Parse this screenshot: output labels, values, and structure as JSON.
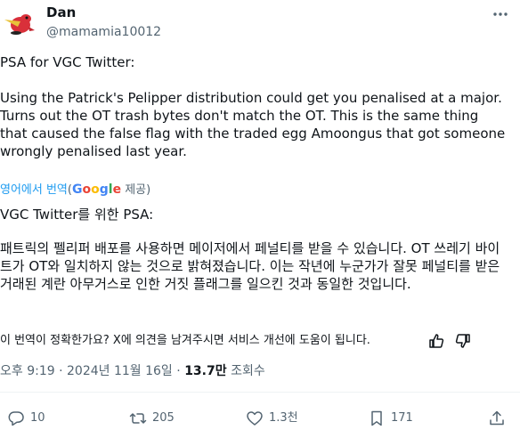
{
  "author": {
    "name": "Dan",
    "handle": "@mamamia10012"
  },
  "tweet": {
    "original_p1": "PSA for VGC Twitter:",
    "original_p2": "Using the Patrick's Pelipper distribution could get you penalised at a major. Turns out the OT trash bytes don't match the OT. This is the same thing that caused the false flag with the traded egg Amoongus that got someone wrongly penalised last year."
  },
  "translation": {
    "link_text": "영어에서 번역",
    "google_label": "Google",
    "paren_open": "(",
    "suffix": " 제공)",
    "p1": "VGC Twitter를 위한 PSA:",
    "p2": "패트릭의 펠리퍼 배포를 사용하면 메이저에서 페널티를 받을 수 있습니다. OT 쓰레기 바이트가 OT와 일치하지 않는 것으로 밝혀졌습니다. 이는 작년에 누군가가 잘못 페널티를 받은 거래된 계란 아무거스로 인한 거짓 플래그를 일으킨 것과 동일한 것입니다.",
    "feedback_question": "이 번역이 정확한가요? X에 의견을 남겨주시면 서비스 개선에 도움이 됩니다."
  },
  "meta": {
    "time": "오후 9:19",
    "dot1": " · ",
    "date": "2024년 11월 16일",
    "dot2": " · ",
    "views": "13.7만",
    "views_label": " 조회수"
  },
  "actions": {
    "replies": "10",
    "reposts": "205",
    "likes": "1.3천",
    "bookmarks": "171"
  },
  "icons": [
    "more-icon",
    "thumbs-up-icon",
    "thumbs-down-icon",
    "reply-icon",
    "repost-icon",
    "like-icon",
    "bookmark-icon",
    "share-icon"
  ],
  "colors": {
    "link": "#1d9bf0",
    "secondary": "#536471",
    "text": "#0f1419"
  }
}
